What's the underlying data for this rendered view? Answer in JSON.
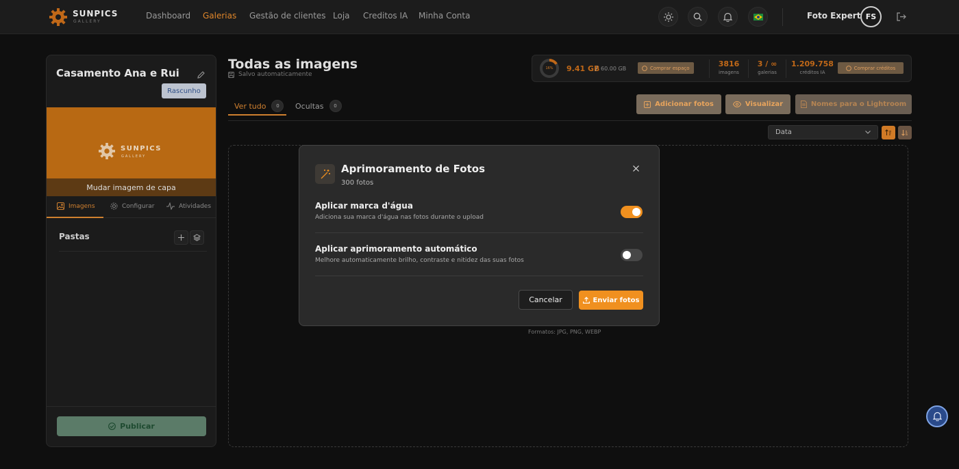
{
  "brand": {
    "name": "SUNPICS",
    "sub": "GALLERY",
    "accent": "#e0862a"
  },
  "nav": {
    "items": [
      "Dashboard",
      "Galerias",
      "Gestão de clientes",
      "Loja",
      "Creditos IA",
      "Minha Conta"
    ],
    "active": "Galerias"
  },
  "header_icons": [
    "sun-icon",
    "search-icon",
    "bell-icon",
    "brazil-flag-icon",
    "logout-icon"
  ],
  "user": {
    "name": "Foto Expert",
    "initials": "FS"
  },
  "gallery": {
    "title": "Casamento Ana e Rui",
    "status": "Rascunho",
    "cover_action": "Mudar imagem de capa",
    "cover_logo": "SUNPICS",
    "cover_logo_sub": "GALLERY"
  },
  "left_tabs": [
    "Imagens",
    "Configurar",
    "Atividades"
  ],
  "folders": {
    "title": "Pastas"
  },
  "publish": "Publicar",
  "page": {
    "title": "Todas as imagens",
    "autosave": "Salvo automaticamente"
  },
  "storage": {
    "percent_label": "16%",
    "percent": 16,
    "used": "9.41 GB",
    "separator": "/",
    "total": "60.00 GB",
    "buy_space": "Comprar espaço",
    "images_count": "3816",
    "images_label": "imagens",
    "galleries_count": "3 / ∞",
    "galleries_label": "galerias",
    "credits": "1.209.758",
    "credits_label": "créditos IA",
    "buy_credits": "Comprar créditos"
  },
  "tabs": [
    {
      "label": "Ver tudo",
      "count": "0"
    },
    {
      "label": "Ocultas",
      "count": "0"
    }
  ],
  "actions": {
    "add": "Adicionar fotos",
    "preview": "Visualizar",
    "lightroom": "Nomes para o Lightroom"
  },
  "sort": {
    "selected": "Data"
  },
  "dropzone": {
    "formats": "Formatos: JPG, PNG, WEBP"
  },
  "modal": {
    "title": "Aprimoramento de Fotos",
    "subtitle": "300 fotos",
    "options": [
      {
        "title": "Aplicar marca d'água",
        "desc": "Adiciona sua marca d'água nas fotos durante o upload",
        "enabled": true
      },
      {
        "title": "Aplicar aprimoramento automático",
        "desc": "Melhore automaticamente brilho, contraste e nitidez das suas fotos",
        "enabled": false
      }
    ],
    "cancel": "Cancelar",
    "submit": "Enviar fotos"
  }
}
